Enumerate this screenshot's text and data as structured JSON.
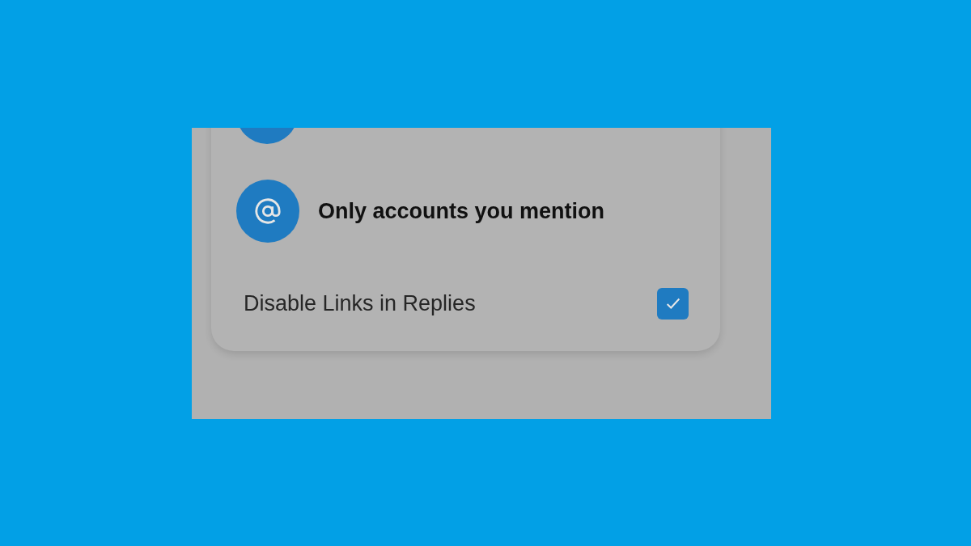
{
  "options": [
    {
      "label": "Only accounts you mention"
    }
  ],
  "toggle": {
    "label": "Disable Links in Replies",
    "checked": true
  }
}
